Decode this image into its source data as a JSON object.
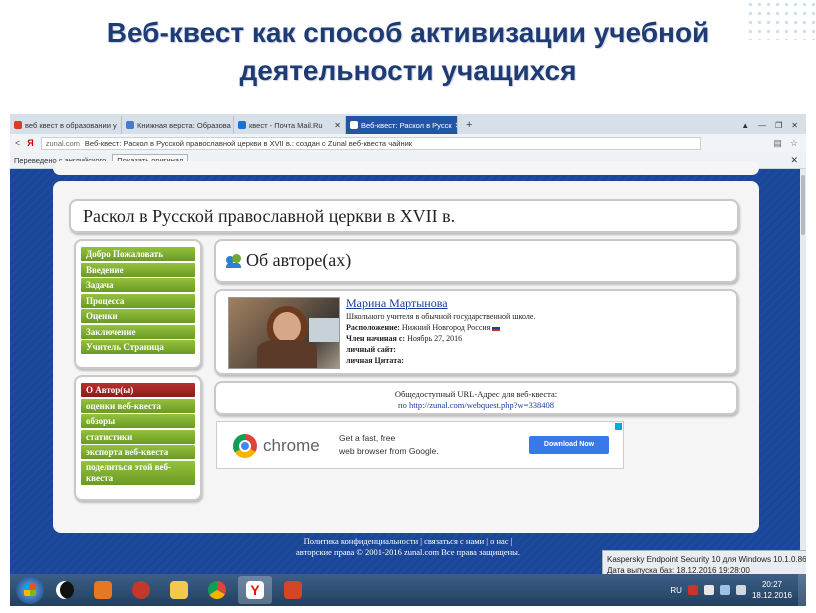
{
  "slide": {
    "title_line1": "Веб-квест  как способ активизации учебной",
    "title_line2": "деятельности учащихся"
  },
  "browser": {
    "tabs": [
      {
        "label": "веб квест в образовании у",
        "icon_color": "#d83b2b",
        "active": false
      },
      {
        "label": "Книжная верста: Образова",
        "icon_color": "#4a7bc8",
        "active": false
      },
      {
        "label": "квест - Почта Mail.Ru",
        "icon_color": "#1a6fd8",
        "active": false
      },
      {
        "label": "Веб-квест: Раскол в Русск",
        "icon_color": "#ffffff",
        "active": true
      }
    ],
    "new_tab": "+",
    "window_controls": [
      "▲",
      "—",
      "❐",
      "✕"
    ],
    "address": {
      "back": "<",
      "yandex": "Я",
      "domain": "zunal.com",
      "title": "Веб-квест: Раскол в Русской православной церкви в XVII в.: создан с Zunal веб-квеста чайник"
    },
    "translate_bar": {
      "label": "Переведено с английского",
      "show_original": "Показать оригинал",
      "close": "✕"
    }
  },
  "page": {
    "header": "Раскол в Русской православной церкви в XVII в.",
    "menu1": [
      "Добро Пожаловать",
      "Введение",
      "Задача",
      "Процесса",
      "Оценки",
      "Заключение",
      "Учитель Страница"
    ],
    "menu2": [
      "О Автор(ы)",
      "оценки веб-квеста",
      "обзоры",
      "статистики",
      "экспорта веб-квеста",
      "поделиться этой веб-квеста"
    ],
    "about_title": "Об авторе(ах)",
    "author": {
      "name": "Марина Мартынова",
      "line1": "Школьного учителя в обычной государственной школе.",
      "location_label": "Расположение:",
      "location_value": "Нижний Новгород Россия",
      "member_label": "Член начиная с:",
      "member_value": "Ноябрь 27, 2016",
      "site_label": "личный сайт:",
      "quote_label": "личная Цитата:"
    },
    "url_box": {
      "label": "Общедоступный URL-Адрес для веб-квеста:",
      "link": "по http://zunal.com/webquest.php?w=338408"
    },
    "ad": {
      "brand": "chrome",
      "text1": "Get a fast, free",
      "text2": "web browser from Google.",
      "button": "Download Now"
    },
    "footer1": "Политика конфиденциальности | связаться с нами | о нас |",
    "footer2": "авторские права © 2001-2016 zunal.com Все права защищены."
  },
  "kaspersky": {
    "line1": "Kaspersky Endpoint Security 10 для Windows 10.1.0.867",
    "line2": "Дата выпуска баз: 18.12.2016 19:28:00"
  },
  "taskbar": {
    "apps": [
      {
        "name": "app-owl",
        "color": "#111111"
      },
      {
        "name": "app-media",
        "color": "#e87722"
      },
      {
        "name": "app-tool",
        "color": "#c0392b"
      },
      {
        "name": "app-folder",
        "color": "#f2c94c"
      },
      {
        "name": "app-chrome",
        "color": "#db4437"
      },
      {
        "name": "app-yandex",
        "color": "#ffffff"
      },
      {
        "name": "app-powerpoint",
        "color": "#d24726"
      }
    ],
    "lang": "RU",
    "time": "20:27",
    "date": "18.12.2016"
  }
}
